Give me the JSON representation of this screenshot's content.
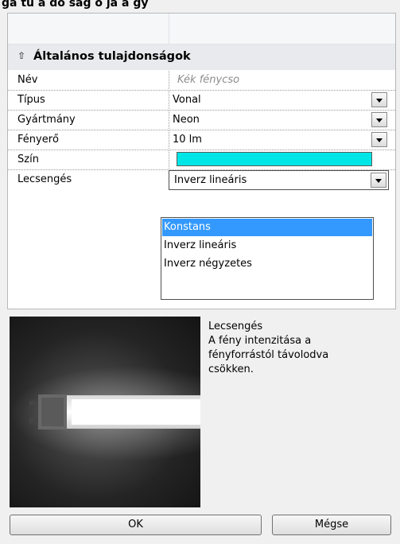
{
  "top_clipped_title": "ga  tu a do ság o   ja  a  gy",
  "section": {
    "title": "Általános tulajdonságok"
  },
  "rows": [
    {
      "label": "Név",
      "value": "Kék fénycso"
    },
    {
      "label": "Típus",
      "value": "Vonal"
    },
    {
      "label": "Gyártmány",
      "value": "Neon"
    },
    {
      "label": "Fényerő",
      "value": "10 lm"
    },
    {
      "label": "Szín",
      "value": "",
      "color": "#00e5e5"
    },
    {
      "label": "Lecsengés",
      "value": "Inverz lineáris"
    }
  ],
  "dropdown_options": [
    "Konstans",
    "Inverz lineáris",
    "Inverz négyzetes"
  ],
  "dropdown_selected_index": 0,
  "description": {
    "title": "Lecsengés",
    "line1": "A fény intenzitása a",
    "line2": "fényforrástól távolodva",
    "line3": "csökken."
  },
  "buttons": {
    "ok": "OK",
    "cancel": "Mégse"
  },
  "icons": [
    "collapse-chevron-icon",
    "dropdown-arrow-icon",
    "fluorescent-tube-icon"
  ]
}
